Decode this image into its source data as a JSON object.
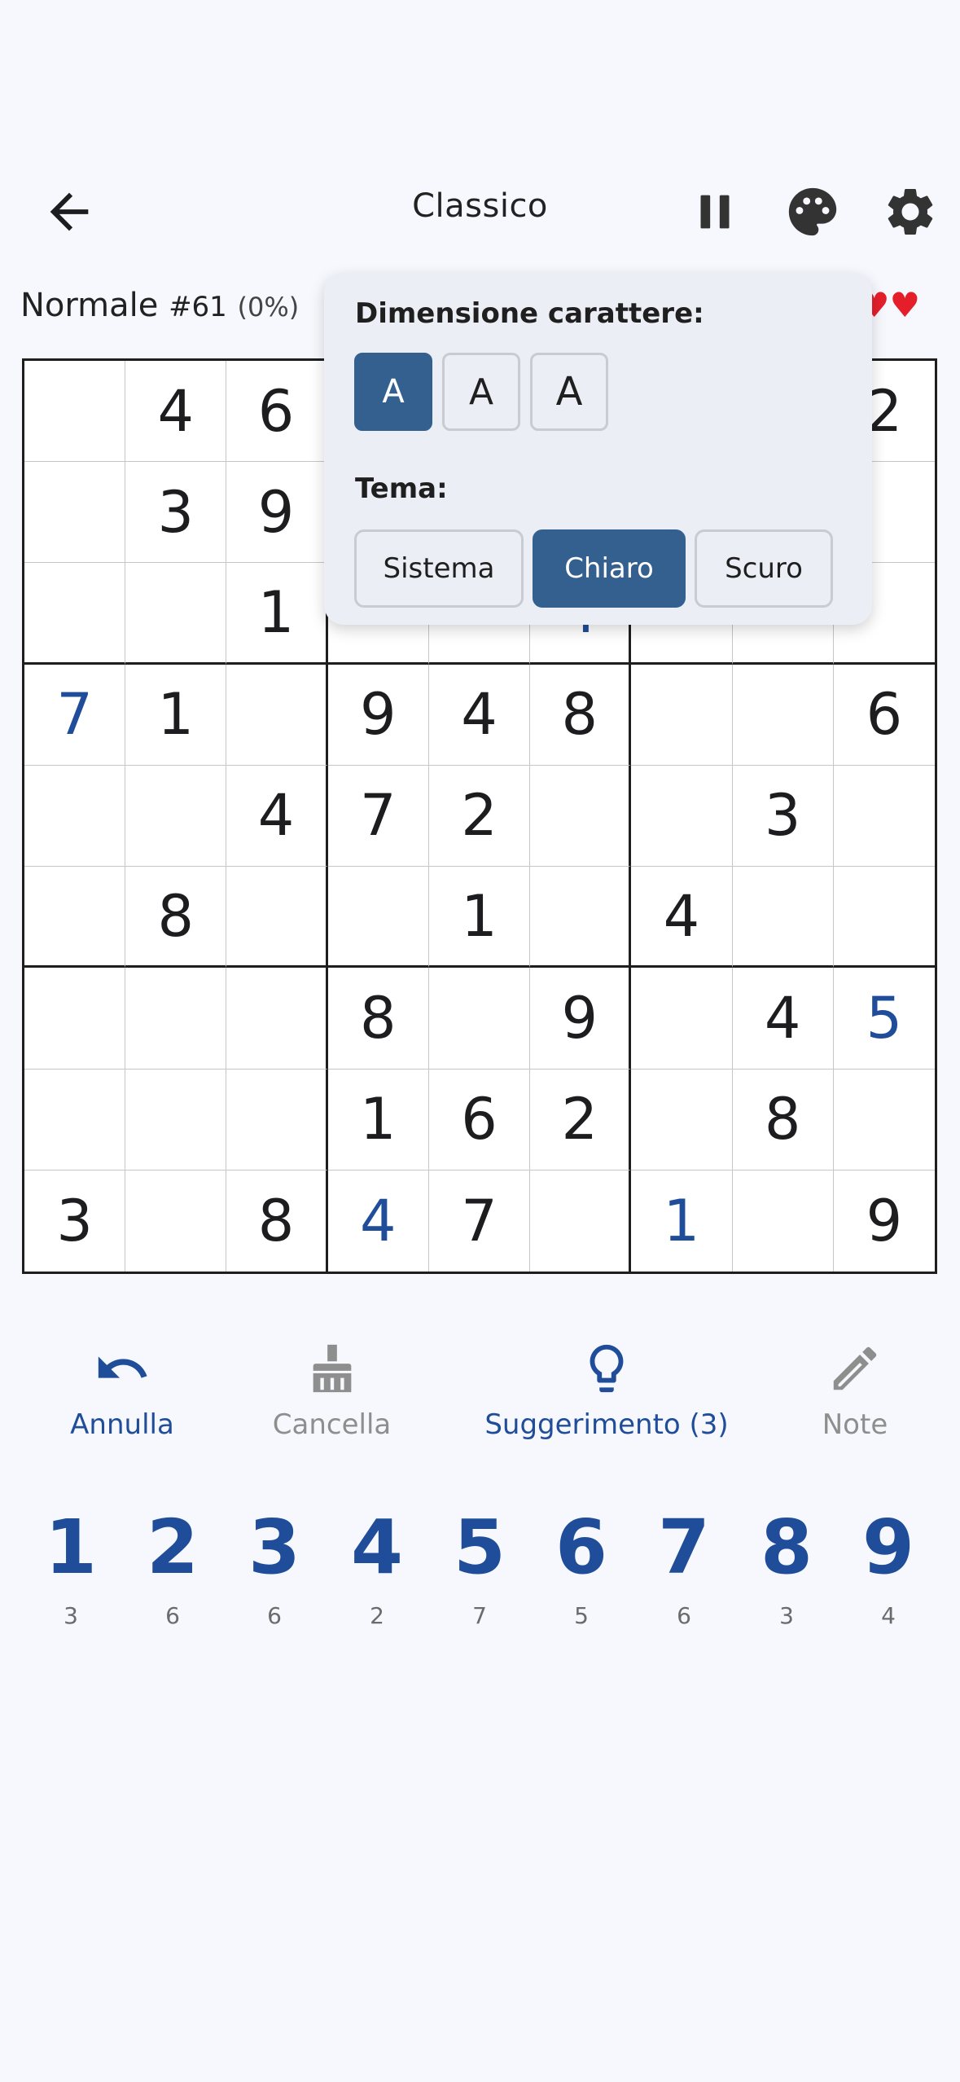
{
  "header": {
    "title": "Classico"
  },
  "info": {
    "difficulty": "Normale",
    "puzzle_number": "#61",
    "progress": "(0%)",
    "lives": 2
  },
  "grid": {
    "cells": [
      [
        "",
        "4",
        "6",
        "",
        "",
        "",
        "",
        "",
        "2"
      ],
      [
        "",
        "3",
        "9",
        "",
        "",
        "",
        "",
        "",
        ""
      ],
      [
        "",
        "",
        "1",
        "",
        "",
        "4",
        "",
        "",
        ""
      ],
      [
        "7",
        "1",
        "",
        "9",
        "4",
        "8",
        "",
        "",
        "6"
      ],
      [
        "",
        "",
        "4",
        "7",
        "2",
        "",
        "",
        "3",
        ""
      ],
      [
        "",
        "8",
        "",
        "",
        "1",
        "",
        "4",
        "",
        ""
      ],
      [
        "",
        "",
        "",
        "8",
        "",
        "9",
        "",
        "4",
        "5"
      ],
      [
        "",
        "",
        "",
        "1",
        "6",
        "2",
        "",
        "8",
        ""
      ],
      [
        "3",
        "",
        "8",
        "4",
        "7",
        "",
        "1",
        "",
        "9"
      ]
    ],
    "user_entered": [
      [
        2,
        5
      ],
      [
        3,
        0
      ],
      [
        6,
        8
      ],
      [
        8,
        3
      ],
      [
        8,
        6
      ]
    ]
  },
  "popup": {
    "font_size_label": "Dimensione carattere:",
    "font_sizes": [
      "A",
      "A",
      "A"
    ],
    "selected_font_size": 0,
    "theme_label": "Tema:",
    "themes": [
      "Sistema",
      "Chiaro",
      "Scuro"
    ],
    "selected_theme": 1
  },
  "toolbar": {
    "undo_label": "Annulla",
    "erase_label": "Cancella",
    "hint_label": "Suggerimento (3)",
    "notes_label": "Note"
  },
  "numpad": [
    {
      "digit": "1",
      "count": "3"
    },
    {
      "digit": "2",
      "count": "6"
    },
    {
      "digit": "3",
      "count": "6"
    },
    {
      "digit": "4",
      "count": "2"
    },
    {
      "digit": "5",
      "count": "7"
    },
    {
      "digit": "6",
      "count": "5"
    },
    {
      "digit": "7",
      "count": "6"
    },
    {
      "digit": "8",
      "count": "3"
    },
    {
      "digit": "9",
      "count": "4"
    }
  ],
  "colors": {
    "accent": "#1f4d9a",
    "selected_button": "#33608f",
    "heart": "#e51f2a",
    "background": "#f7f8fd"
  }
}
